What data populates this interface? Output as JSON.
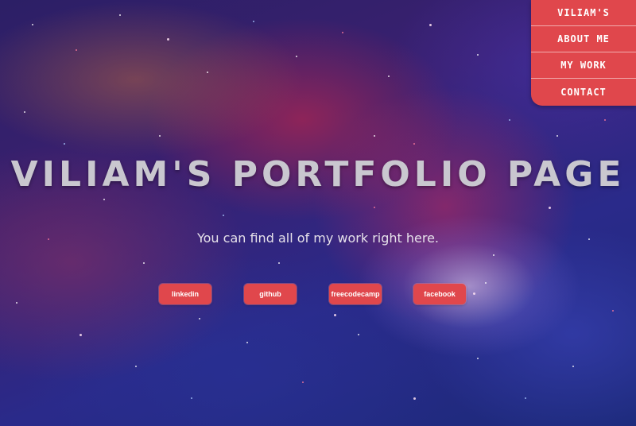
{
  "nav": {
    "items": [
      {
        "label": "VILIAM'S"
      },
      {
        "label": "ABOUT ME"
      },
      {
        "label": "MY WORK"
      },
      {
        "label": "CONTACT"
      }
    ]
  },
  "hero": {
    "title": "VILIAM'S PORTFOLIO PAGE",
    "subtitle": "You can find all of my work right here.",
    "links": [
      {
        "label": "linkedin"
      },
      {
        "label": "github"
      },
      {
        "label": "freecodecamp"
      },
      {
        "label": "facebook"
      }
    ]
  },
  "colors": {
    "accent": "#e0474c",
    "title": "#c9c7cf",
    "subtitle": "#e6e1ea"
  }
}
